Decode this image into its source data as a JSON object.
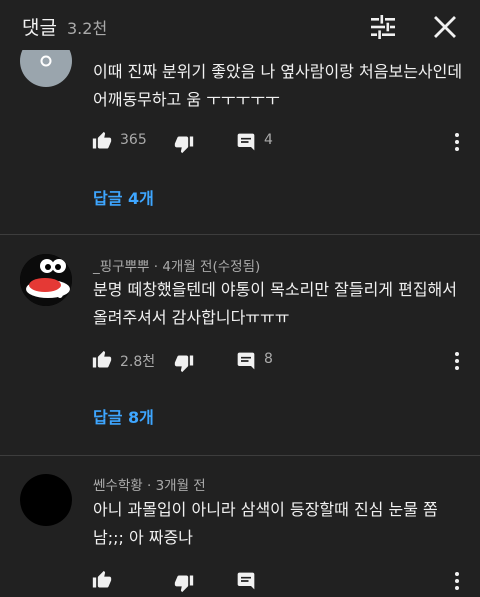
{
  "header": {
    "title": "댓글",
    "count": "3.2천"
  },
  "comments": [
    {
      "author": "",
      "time": "",
      "text": "이때 진짜 분위기 좋았음 나 옆사람이랑 처음보는사인데 어깨동무하고 움 ㅜㅜㅜㅜㅜ",
      "likes": "365",
      "reply_count": "4",
      "replies_label": "답글 4개"
    },
    {
      "author": "_핑구뿌뿌",
      "time": "4개월 전(수정됨)",
      "text": "분명 떼창했을텐데 야통이 목소리만 잘들리게 편집해서 올려주셔서 감사합니다ㅠㅠㅠ",
      "likes": "2.8천",
      "reply_count": "8",
      "replies_label": "답글 8개"
    },
    {
      "author": "쎈수학황",
      "time": "3개월 전",
      "text": "아니 과몰입이 아니라 삼색이 등장할때 진심 눈물 쫌 남;;; 아 짜증나",
      "likes": "",
      "reply_count": "",
      "replies_label": ""
    }
  ]
}
